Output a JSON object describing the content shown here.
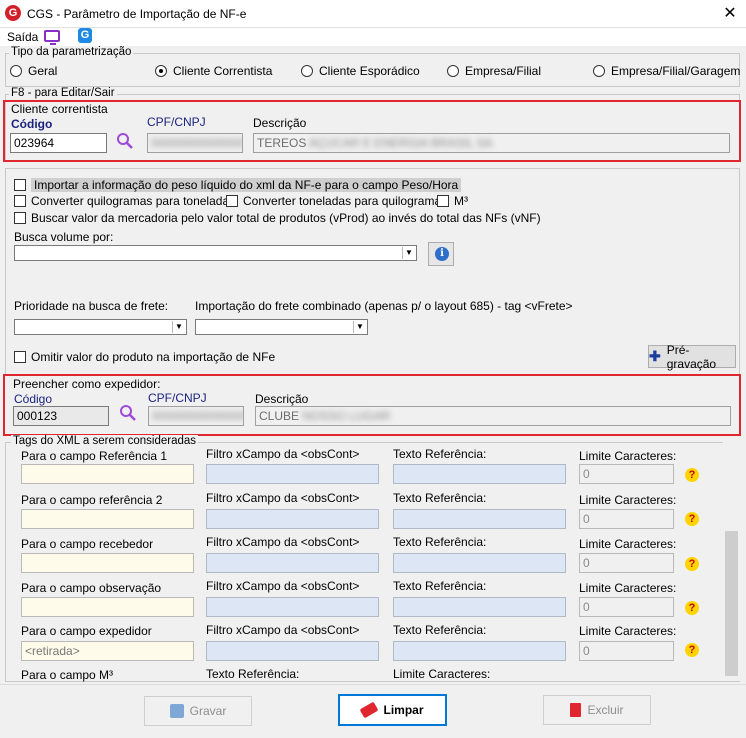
{
  "window": {
    "title": "CGS - Parâmetro de Importação de NF-e",
    "app_icon": "G",
    "close": "✕"
  },
  "menu": {
    "saida": "Saída",
    "g_icon": "G"
  },
  "tipo": {
    "legend": "Tipo da parametrização",
    "options": [
      "Geral",
      "Cliente Correntista",
      "Cliente Esporádico",
      "Empresa/Filial",
      "Empresa/Filial/Garagem"
    ],
    "selected": "Cliente Correntista"
  },
  "f8": {
    "legend": "F8 - para Editar/Sair"
  },
  "cliente": {
    "legend": "Cliente correntista",
    "codigo_label": "Código",
    "codigo_value": "023964",
    "cpf_label": "CPF/CNPJ",
    "cpf_value": "00000000000000",
    "descricao_label": "Descrição",
    "descricao_prefix": "TEREOS",
    "descricao_blur": "AÇUCAR E ENERGIA BRASIL SA"
  },
  "options": {
    "importar_peso": "Importar a informação do peso líquido do xml da NF-e para o campo Peso/Hora",
    "kg_ton": "Converter quilogramas para toneladas",
    "ton_kg": "Converter toneladas para quilogramas",
    "m3": "M³",
    "vprod": "Buscar valor da mercadoria pelo valor total de produtos (vProd) ao invés do total das NFs (vNF)",
    "busca_volume_label": "Busca volume por:",
    "prioridade_label": "Prioridade na busca de frete:",
    "frete_combinado_label": "Importação do frete combinado (apenas p/ o layout 685) - tag <vFrete>",
    "omitir": "Omitir valor do produto na importação de NFe",
    "pre_gravacao": "Pré-gravação"
  },
  "expedidor": {
    "legend": "Preencher como expedidor:",
    "codigo_label": "Código",
    "codigo_value": "000123",
    "cpf_label": "CPF/CNPJ",
    "cpf_value": "00000000000000",
    "descricao_label": "Descrição",
    "descricao_prefix": "CLUBE",
    "descricao_blur": "NOSSO LUGAR"
  },
  "tags": {
    "legend": "Tags do XML a serem consideradas",
    "filtro_label": "Filtro xCampo da <obsCont>",
    "texto_ref_label": "Texto Referência:",
    "limite_label": "Limite Caracteres:",
    "limite_default": "0",
    "rows": [
      {
        "label": "Para o campo Referência 1",
        "value": ""
      },
      {
        "label": "Para o campo referência 2",
        "value": ""
      },
      {
        "label": "Para o campo recebedor",
        "value": ""
      },
      {
        "label": "Para o campo observação",
        "value": ""
      },
      {
        "label": "Para o campo expedidor",
        "value": "<retirada>"
      }
    ],
    "last_row_label": "Para o campo M³",
    "last_texto_label": "Texto Referência:",
    "last_limite_label": "Limite Caracteres:"
  },
  "buttons": {
    "gravar": "Gravar",
    "limpar": "Limpar",
    "excluir": "Excluir"
  },
  "colors": {
    "accent_red": "#e0262e",
    "label_blue": "#1a237e",
    "search_purple": "#9c4bd6"
  }
}
